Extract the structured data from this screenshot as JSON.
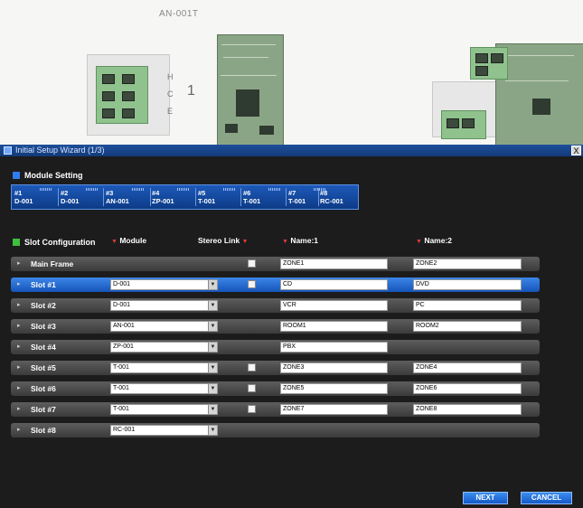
{
  "photo": {
    "caption": "AN-001T",
    "terminal_letters": [
      "H",
      "C",
      "E"
    ],
    "terminal_number": "1"
  },
  "window": {
    "title": "Initial Setup Wizard (1/3)",
    "close_label": "X"
  },
  "module_setting": {
    "title": "Module Setting",
    "accent": "#2f7df0",
    "slots": [
      {
        "num": "#1",
        "module": "D-001"
      },
      {
        "num": "#2",
        "module": "D-001"
      },
      {
        "num": "#3",
        "module": "AN-001"
      },
      {
        "num": "#4",
        "module": "ZP-001"
      },
      {
        "num": "#5",
        "module": "T-001"
      },
      {
        "num": "#6",
        "module": "T-001"
      },
      {
        "num": "#7",
        "module": "T-001"
      },
      {
        "num": "#8",
        "module": "RC-001"
      }
    ]
  },
  "slot_configuration": {
    "title": "Slot Configuration",
    "accent": "#3fbf3f",
    "headers": {
      "module": "Module",
      "stereo_link": "Stereo Link",
      "name1": "Name:1",
      "name2": "Name:2"
    },
    "rows": [
      {
        "label": "Main Frame",
        "module": "",
        "stereo": true,
        "name1": "ZONE1",
        "name2": "ZONE2",
        "selected": false
      },
      {
        "label": "Slot #1",
        "module": "D-001",
        "stereo": true,
        "name1": "CD",
        "name2": "DVD",
        "selected": true
      },
      {
        "label": "Slot #2",
        "module": "D-001",
        "stereo": false,
        "name1": "VCR",
        "name2": "PC",
        "selected": false
      },
      {
        "label": "Slot #3",
        "module": "AN-001",
        "stereo": false,
        "name1": "ROOM1",
        "name2": "ROOM2",
        "selected": false
      },
      {
        "label": "Slot #4",
        "module": "ZP-001",
        "stereo": false,
        "name1": "PBX",
        "name2": "",
        "selected": false
      },
      {
        "label": "Slot #5",
        "module": "T-001",
        "stereo": true,
        "name1": "ZONE3",
        "name2": "ZONE4",
        "selected": false
      },
      {
        "label": "Slot #6",
        "module": "T-001",
        "stereo": true,
        "name1": "ZONE5",
        "name2": "ZONE6",
        "selected": false
      },
      {
        "label": "Slot #7",
        "module": "T-001",
        "stereo": true,
        "name1": "ZONE7",
        "name2": "ZONE8",
        "selected": false
      },
      {
        "label": "Slot #8",
        "module": "RC-001",
        "stereo": false,
        "name1": "",
        "name2": "",
        "selected": false
      }
    ]
  },
  "buttons": {
    "next": "NEXT",
    "cancel": "CANCEL"
  }
}
